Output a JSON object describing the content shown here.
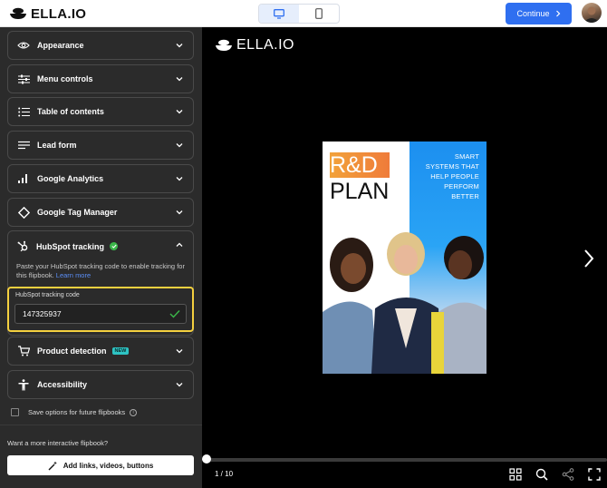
{
  "app": {
    "logo_text": "ELLA.IO"
  },
  "topbar": {
    "continue_label": "Continue",
    "device_options": [
      "desktop",
      "mobile"
    ],
    "active_device": "desktop"
  },
  "sidebar": {
    "panels": [
      {
        "label": "Appearance",
        "icon": "eye-icon"
      },
      {
        "label": "Menu controls",
        "icon": "sliders-icon"
      },
      {
        "label": "Table of contents",
        "icon": "list-icon"
      },
      {
        "label": "Lead form",
        "icon": "form-lines-icon"
      },
      {
        "label": "Google Analytics",
        "icon": "bar-chart-icon"
      },
      {
        "label": "Google Tag Manager",
        "icon": "diamond-icon"
      }
    ],
    "hubspot": {
      "label": "HubSpot tracking",
      "description": "Paste your HubSpot tracking code to enable tracking for this flipbook.",
      "learn_more": "Learn more",
      "field_label": "HubSpot tracking code",
      "field_value": "147325937"
    },
    "product_detection": {
      "label": "Product detection",
      "badge": "NEW"
    },
    "accessibility": {
      "label": "Accessibility"
    },
    "save_options_label": "Save options for future flipbooks",
    "promo_text": "Want a more interactive flipbook?",
    "promo_button": "Add links, videos, buttons"
  },
  "preview": {
    "logo_text": "ELLA.IO",
    "cover": {
      "title_top": "R&D",
      "title_bottom": "PLAN",
      "tagline_lines": [
        "SMART",
        "SYSTEMS THAT",
        "HELP PEOPLE",
        "PERFORM",
        "BETTER"
      ]
    },
    "page_indicator": "1 / 10",
    "progress": 0.0
  },
  "colors": {
    "accent": "#2f6ff0",
    "highlight": "#f4d03f",
    "success": "#3bb84a",
    "new_badge": "#2ec4c4"
  }
}
